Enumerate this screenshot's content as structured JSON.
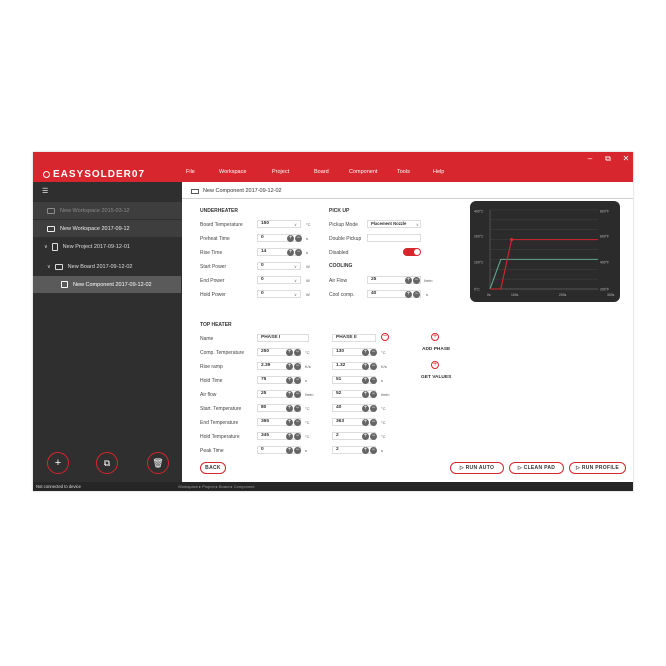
{
  "window": {
    "controls": {
      "minimize": "–",
      "maximize": "⧉",
      "close": "✕"
    }
  },
  "app": {
    "name": "EASYSOLDER07"
  },
  "menu": [
    "File",
    "Workspace",
    "Project",
    "Board",
    "Component",
    "Tools",
    "Help"
  ],
  "sidebar": {
    "menu_icon": "☰",
    "tree": [
      {
        "label": "New Workspace 2015-03-12",
        "icon": "workspace-icon"
      },
      {
        "label": "New Workspace 2017-09-12",
        "icon": "workspace-icon"
      },
      {
        "label": "New Project 2017-09-12-01",
        "icon": "project-icon"
      },
      {
        "label": "New Board 2017-09-12-02",
        "icon": "board-icon"
      },
      {
        "label": "New Component 2017-09-12-02",
        "icon": "component-icon"
      }
    ],
    "buttons": {
      "add": "+",
      "copy": "⧉",
      "delete": "🗑"
    }
  },
  "tab": {
    "title": "New Component 2017-09-12-02"
  },
  "underheater": {
    "heading": "UNDERHEATER",
    "rows": [
      {
        "label": "Board Temperature",
        "value": "150",
        "unit": "°C"
      },
      {
        "label": "Preheat Time",
        "value": "0",
        "unit": "s"
      },
      {
        "label": "Rise Time",
        "value": "14",
        "unit": "s"
      },
      {
        "label": "Start Power",
        "value": "0",
        "unit": "W"
      },
      {
        "label": "End Power",
        "value": "0",
        "unit": "W"
      },
      {
        "label": "Hold Power",
        "value": "0",
        "unit": "W"
      }
    ]
  },
  "pickup": {
    "heading": "PICK UP",
    "mode_label": "Pickup Mode",
    "mode_value": "Placement Nozzle",
    "double_label": "Double Pickup",
    "disabled_label": "Disabled",
    "disabled_on": true
  },
  "cooling": {
    "heading": "COOLING",
    "rows": [
      {
        "label": "Air Flow",
        "value": "25",
        "unit": "l/min"
      },
      {
        "label": "Cool comp.",
        "value": "40",
        "unit": "s"
      }
    ]
  },
  "chart_data": {
    "type": "line",
    "y_left_ticks": [
      "400°C",
      "200°C",
      "100°C",
      "0°C"
    ],
    "y_right_ticks": [
      "800°F",
      "600°F",
      "400°F",
      "200°F"
    ],
    "x_ticks": [
      "0s",
      "100s",
      "200s",
      "300s"
    ],
    "xlim": [
      0,
      300
    ],
    "ylim": [
      0,
      400
    ],
    "series": [
      {
        "color": "#d7262d",
        "x": [
          0,
          30,
          60,
          300
        ],
        "y": [
          0,
          0,
          250,
          250
        ]
      },
      {
        "color": "#5fa58c",
        "x": [
          0,
          30,
          300
        ],
        "y": [
          0,
          150,
          150
        ]
      }
    ]
  },
  "top_heater": {
    "heading": "TOP HEATER",
    "name_label": "Name",
    "phase1_name": "PHASE I",
    "phase2_name": "PHASE II",
    "rows": [
      {
        "label": "Comp. Temperature",
        "p1": "250",
        "u1": "°C",
        "p2": "130",
        "u2": "°C"
      },
      {
        "label": "Rise ramp",
        "p1": "2.39",
        "u1": "K/s",
        "p2": "1.32",
        "u2": "K/s"
      },
      {
        "label": "Hold Time",
        "p1": "75",
        "u1": "s",
        "p2": "51",
        "u2": "s"
      },
      {
        "label": "Air flow",
        "p1": "25",
        "u1": "l/min",
        "p2": "52",
        "u2": "l/min"
      },
      {
        "label": "Start. Temperature",
        "p1": "80",
        "u1": "°C",
        "p2": "40",
        "u2": "°C"
      },
      {
        "label": "End Temperature",
        "p1": "365",
        "u1": "°C",
        "p2": "363",
        "u2": "°C"
      },
      {
        "label": "Hold Temperature",
        "p1": "345",
        "u1": "°C",
        "p2": "2",
        "u2": "°C"
      },
      {
        "label": "Peak Time",
        "p1": "0",
        "u1": "s",
        "p2": "2",
        "u2": "s"
      }
    ],
    "add_phase": "ADD PHASE",
    "get_values": "GET VALUES"
  },
  "actions": {
    "back": "BACK",
    "run_auto": "▷ RUN AUTO",
    "clean_pad": "▷ CLEAN PAD",
    "run_profile": "▷ RUN PROFILE"
  },
  "status": {
    "connection": "Not connected to device",
    "breadcrumb": "Workspace   ▸   Project   ▸   Board   ▸   Component"
  }
}
